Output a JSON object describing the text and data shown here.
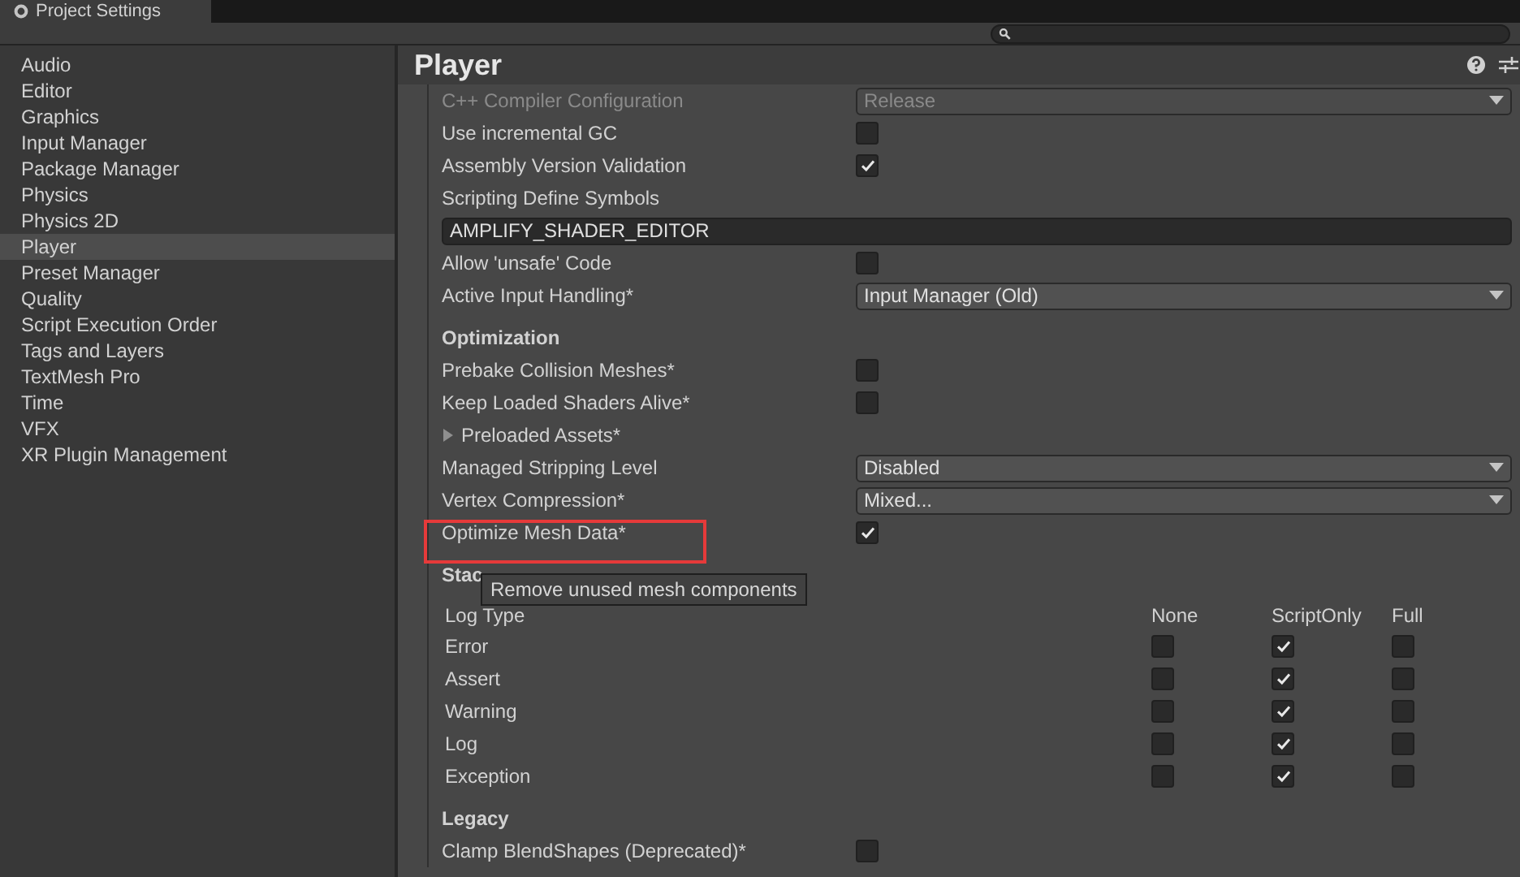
{
  "window": {
    "title": "Project Settings"
  },
  "sidebar": {
    "items": [
      {
        "label": "Audio",
        "selected": false
      },
      {
        "label": "Editor",
        "selected": false
      },
      {
        "label": "Graphics",
        "selected": false
      },
      {
        "label": "Input Manager",
        "selected": false
      },
      {
        "label": "Package Manager",
        "selected": false
      },
      {
        "label": "Physics",
        "selected": false
      },
      {
        "label": "Physics 2D",
        "selected": false
      },
      {
        "label": "Player",
        "selected": true
      },
      {
        "label": "Preset Manager",
        "selected": false
      },
      {
        "label": "Quality",
        "selected": false
      },
      {
        "label": "Script Execution Order",
        "selected": false
      },
      {
        "label": "Tags and Layers",
        "selected": false
      },
      {
        "label": "TextMesh Pro",
        "selected": false
      },
      {
        "label": "Time",
        "selected": false
      },
      {
        "label": "VFX",
        "selected": false
      },
      {
        "label": "XR Plugin Management",
        "selected": false
      }
    ]
  },
  "panel": {
    "title": "Player",
    "rows": [
      {
        "kind": "dropdown",
        "label": "C++ Compiler Configuration",
        "value": "Release",
        "disabled": true
      },
      {
        "kind": "checkbox",
        "label": "Use incremental GC",
        "checked": false
      },
      {
        "kind": "checkbox",
        "label": "Assembly Version Validation",
        "checked": true
      },
      {
        "kind": "label",
        "label": "Scripting Define Symbols"
      },
      {
        "kind": "text",
        "value": "AMPLIFY_SHADER_EDITOR"
      },
      {
        "kind": "checkbox",
        "label": "Allow 'unsafe' Code",
        "checked": false
      },
      {
        "kind": "dropdown",
        "label": "Active Input Handling*",
        "value": "Input Manager (Old)",
        "disabled": false
      },
      {
        "kind": "header",
        "label": "Optimization"
      },
      {
        "kind": "checkbox",
        "label": "Prebake Collision Meshes*",
        "checked": false
      },
      {
        "kind": "checkbox",
        "label": "Keep Loaded Shaders Alive*",
        "checked": false
      },
      {
        "kind": "foldout",
        "label": "Preloaded Assets*",
        "expanded": false
      },
      {
        "kind": "dropdown",
        "label": "Managed Stripping Level",
        "value": "Disabled",
        "disabled": false
      },
      {
        "kind": "dropdown",
        "label": "Vertex Compression*",
        "value": "Mixed...",
        "disabled": false
      },
      {
        "kind": "checkbox",
        "label": "Optimize Mesh Data*",
        "checked": true,
        "highlighted": true
      },
      {
        "kind": "header",
        "label": "Stac"
      }
    ],
    "tooltip": "Remove unused mesh components",
    "stack_trace": {
      "row_header": "Log Type",
      "columns": [
        "None",
        "ScriptOnly",
        "Full"
      ],
      "rows": [
        {
          "label": "Error",
          "checked": [
            false,
            true,
            false
          ]
        },
        {
          "label": "Assert",
          "checked": [
            false,
            true,
            false
          ]
        },
        {
          "label": "Warning",
          "checked": [
            false,
            true,
            false
          ]
        },
        {
          "label": "Log",
          "checked": [
            false,
            true,
            false
          ]
        },
        {
          "label": "Exception",
          "checked": [
            false,
            true,
            false
          ]
        }
      ]
    },
    "legacy": {
      "title": "Legacy",
      "rows": [
        {
          "kind": "checkbox",
          "label": "Clamp BlendShapes (Deprecated)*",
          "checked": false
        }
      ]
    }
  }
}
